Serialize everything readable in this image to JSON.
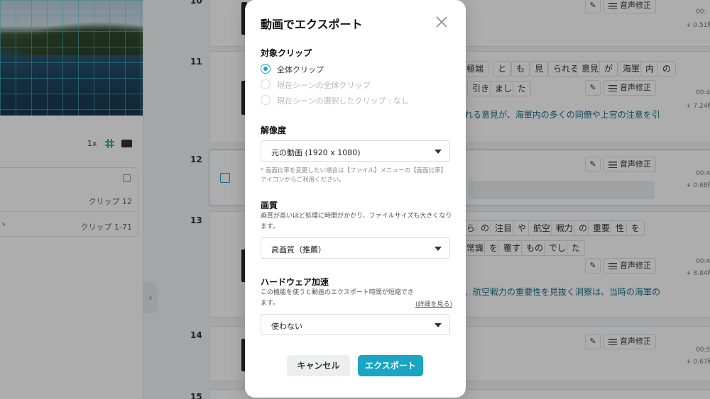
{
  "background": {
    "player": {
      "speed": "1x"
    },
    "clip_list": {
      "rows": [
        {
          "label": "クリップ 12"
        },
        {
          "label": "クリップ 1-71",
          "prefix": "ゝ"
        }
      ]
    },
    "rows": [
      {
        "num": "10",
        "time": "00:",
        "dur": "+ 0.51秒"
      },
      {
        "num": "11",
        "time": "00:4",
        "dur": "+ 7.24秒",
        "words_line1": [
          "極端",
          "と",
          "も",
          "見",
          "られる",
          "意見",
          "が",
          "海軍",
          "内",
          "の"
        ],
        "words_line2": [
          "引き",
          "まし",
          "た"
        ],
        "subtitle": "れる意見が、海軍内の多くの同僚や上官の注意を引"
      },
      {
        "num": "12",
        "time": "00:4",
        "dur": "+ 0.68秒"
      },
      {
        "num": "13",
        "time": "00:4",
        "dur": "+ 8.84秒",
        "words_line1": [
          "ら",
          "の",
          "注目",
          "や",
          "航空",
          "戦力",
          "の",
          "重要",
          "性",
          "を"
        ],
        "words_line2": [
          "常識",
          "を",
          "覆す",
          "もの",
          "でし",
          "た"
        ],
        "subtitle": "、航空戦力の重要性を見抜く洞察は、当時の海軍の"
      },
      {
        "num": "14",
        "time": "00:5",
        "dur": "+ 0.67秒"
      },
      {
        "num": "15"
      }
    ],
    "audio_button_label": "音声修正"
  },
  "modal": {
    "title": "動画でエクスポート",
    "target_clip": {
      "title": "対象クリップ",
      "options": [
        {
          "label": "全体クリップ",
          "selected": true,
          "disabled": false
        },
        {
          "label": "現在シーンの全体クリップ",
          "selected": false,
          "disabled": true
        },
        {
          "label": "現在シーンの選択したクリップ : なし",
          "selected": false,
          "disabled": true
        }
      ]
    },
    "resolution": {
      "title": "解像度",
      "value": "元の動画 (1920 x 1080)",
      "note_line1": "* 画面比率を変更したい場合は【ファイル】メニューの【画面比率】",
      "note_line2": "アイコンからご利用ください。"
    },
    "quality": {
      "title": "画質",
      "desc_line1": "画質が高いほど処理に時間がかかり、ファイルサイズも大きくなり",
      "desc_line2": "ます。",
      "value": "高画質（推薦）"
    },
    "hardware": {
      "title": "ハードウェア加速",
      "desc_line1": "この機能を使うと動画のエクスポート時間が短縮でき",
      "desc_line2": "ます。",
      "link": "(詳細を見る)",
      "value": "使わない"
    },
    "buttons": {
      "cancel": "キャンセル",
      "export": "エクスポート"
    }
  },
  "colors": {
    "accent": "#1aa5c4",
    "cancel_bg": "#eceeef"
  }
}
